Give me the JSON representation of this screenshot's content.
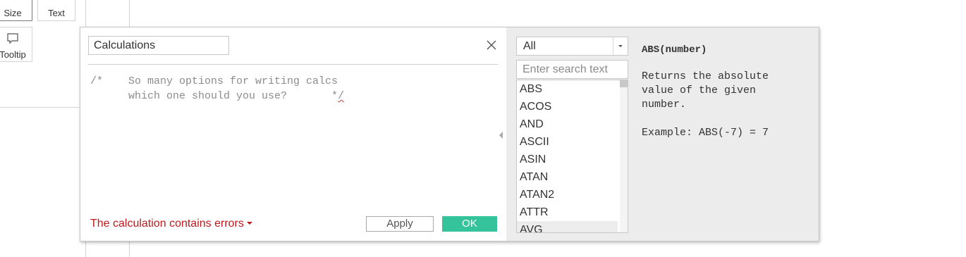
{
  "marks": {
    "size_label": "Size",
    "text_label": "Text",
    "tooltip_label": "Tooltip"
  },
  "dialog": {
    "name_value": "Calculations",
    "editor_line1": "/*    So many options for writing calcs",
    "editor_line2_text": "      which one should you use?       *",
    "editor_line2_error": "/",
    "error_status": "The calculation contains errors",
    "apply_label": "Apply",
    "ok_label": "OK"
  },
  "functions_panel": {
    "category_selected": "All",
    "search_placeholder": "Enter search text",
    "items": [
      "ABS",
      "ACOS",
      "AND",
      "ASCII",
      "ASIN",
      "ATAN",
      "ATAN2",
      "ATTR",
      "AVG"
    ],
    "help": {
      "signature": "ABS(number)",
      "description": "Returns the absolute\nvalue of the given\nnumber.",
      "example": "Example: ABS(-7) = 7"
    }
  },
  "colors": {
    "ok_button": "#34c39a",
    "error_text": "#c0181b",
    "panel_bg": "#ececec"
  }
}
